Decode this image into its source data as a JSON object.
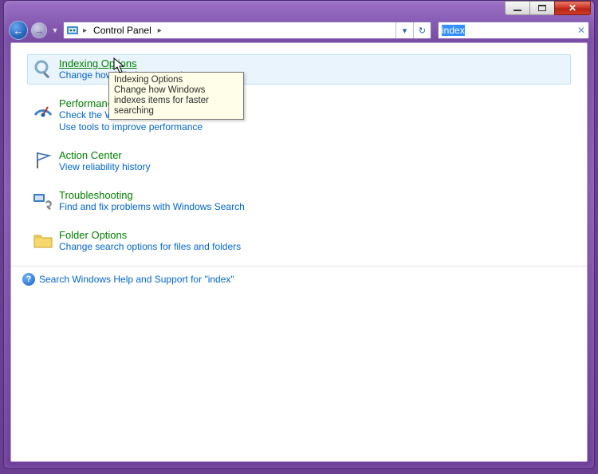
{
  "breadcrumb": {
    "root": "Control Panel"
  },
  "search": {
    "value": "index"
  },
  "results": [
    {
      "title": "Indexing Options",
      "subs": [
        "Change how Windows searches"
      ],
      "icon": "magnifier"
    },
    {
      "title": "Performance Information and Tools",
      "subs": [
        "Check the Windows Experience Index",
        "Use tools to improve performance"
      ],
      "icon": "meter"
    },
    {
      "title": "Action Center",
      "subs": [
        "View reliability history"
      ],
      "icon": "flag"
    },
    {
      "title": "Troubleshooting",
      "subs": [
        "Find and fix problems with Windows Search"
      ],
      "icon": "wrench"
    },
    {
      "title": "Folder Options",
      "subs": [
        "Change search options for files and folders"
      ],
      "icon": "folder"
    }
  ],
  "help_link": "Search Windows Help and Support for \"index\"",
  "tooltip": {
    "title": "Indexing Options",
    "body": "Change how Windows indexes items for faster searching"
  }
}
